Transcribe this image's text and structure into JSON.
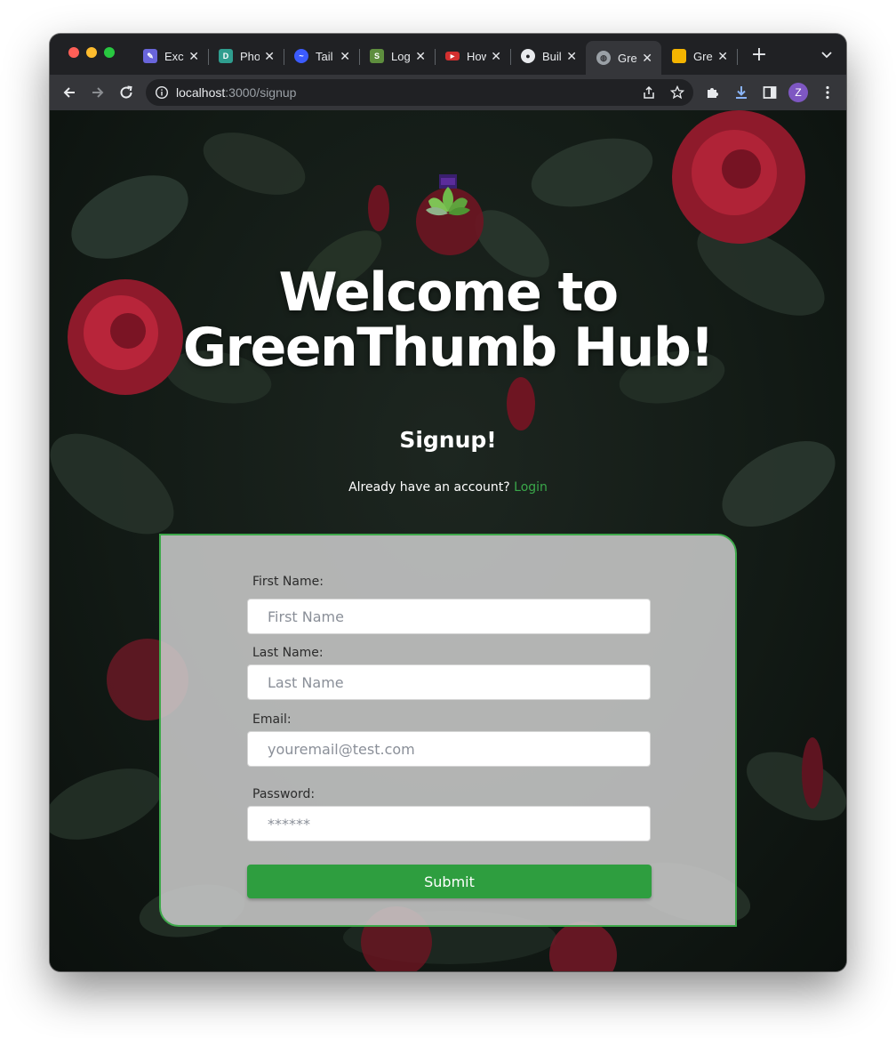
{
  "browser": {
    "tabs": [
      {
        "title": "Exc",
        "icon": "excalidraw-icon",
        "color": "#6965db"
      },
      {
        "title": "Pho",
        "icon": "document-icon",
        "color": "#2f9e8f"
      },
      {
        "title": "Tail",
        "icon": "tailwind-icon",
        "color": "#3b5bfd"
      },
      {
        "title": "Log",
        "icon": "shopify-icon",
        "color": "#5e8e3e"
      },
      {
        "title": "How",
        "icon": "youtube-icon",
        "color": "#d32f2f"
      },
      {
        "title": "Buil",
        "icon": "github-icon",
        "color": "#e8eaed"
      },
      {
        "title": "Gre",
        "icon": "globe-icon",
        "color": "#9aa0a6",
        "active": true
      },
      {
        "title": "Gre",
        "icon": "slides-icon",
        "color": "#f4b400"
      }
    ],
    "tab_close_glyph": "✕",
    "new_tab_glyph": "+",
    "url_host": "localhost",
    "url_path": ":3000/signup",
    "profile_initial": "Z"
  },
  "page": {
    "title_line1": "Welcome to",
    "title_line2": "GreenThumb Hub!",
    "subtitle": "Signup!",
    "login_prompt": "Already have an account?",
    "login_link": "Login",
    "form": {
      "first_name_label": "First Name:",
      "first_name_placeholder": "First Name",
      "last_name_label": "Last Name:",
      "last_name_placeholder": "Last Name",
      "email_label": "Email:",
      "email_placeholder": "youremail@test.com",
      "password_label": "Password:",
      "password_placeholder": "******",
      "submit_label": "Submit"
    }
  },
  "colors": {
    "accent_green": "#2e9e3f",
    "link_green": "#3aa84a",
    "card_border": "#3ea84b"
  }
}
